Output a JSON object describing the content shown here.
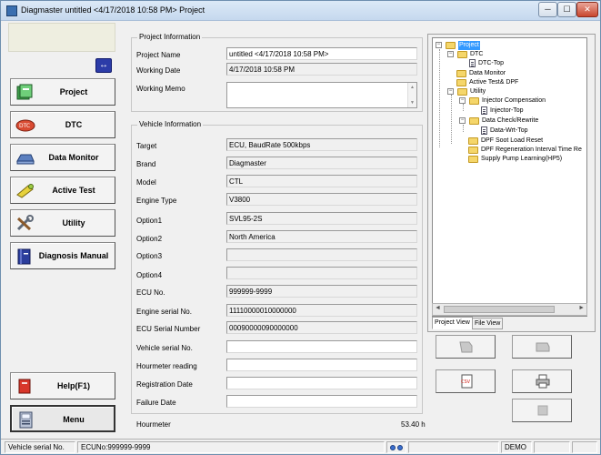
{
  "window": {
    "title": "Diagmaster untitled <4/17/2018 10:58 PM> Project",
    "minimize_glyph": "─",
    "maximize_glyph": "☐",
    "close_glyph": "✕"
  },
  "sidebar": {
    "swap_glyph": "↔",
    "items": [
      {
        "label": "Project",
        "icon": "project-icon"
      },
      {
        "label": "DTC",
        "icon": "dtc-icon"
      },
      {
        "label": "Data Monitor",
        "icon": "data-monitor-icon"
      },
      {
        "label": "Active Test",
        "icon": "active-test-icon"
      },
      {
        "label": "Utility",
        "icon": "utility-icon"
      },
      {
        "label": "Diagnosis Manual",
        "icon": "manual-icon"
      }
    ],
    "help_label": "Help(F1)",
    "menu_label": "Menu"
  },
  "project_info": {
    "group_title": "Project Information",
    "project_name_label": "Project Name",
    "project_name_value": "untitled <4/17/2018 10:58 PM>",
    "working_date_label": "Working Date",
    "working_date_value": "4/17/2018 10:58 PM",
    "working_memo_label": "Working Memo",
    "working_memo_value": ""
  },
  "vehicle_info": {
    "group_title": "Vehicle Information",
    "fields": [
      {
        "label": "Target",
        "value": "ECU, BaudRate 500kbps"
      },
      {
        "label": "Brand",
        "value": "Diagmaster"
      },
      {
        "label": "Model",
        "value": "CTL"
      },
      {
        "label": "Engine Type",
        "value": "V3800"
      },
      {
        "label": "Option1",
        "value": "SVL95-2S"
      },
      {
        "label": "Option2",
        "value": "North America"
      },
      {
        "label": "Option3",
        "value": ""
      },
      {
        "label": "Option4",
        "value": ""
      },
      {
        "label": "ECU No.",
        "value": "999999-9999"
      },
      {
        "label": "Engine serial No.",
        "value": "11110000010000000"
      },
      {
        "label": "ECU Serial Number",
        "value": "00090000090000000"
      },
      {
        "label": "Vehicle serial No.",
        "value": ""
      },
      {
        "label": "Hourmeter reading",
        "value": ""
      },
      {
        "label": "Registration Date",
        "value": ""
      },
      {
        "label": "Failure Date",
        "value": ""
      }
    ],
    "hourmeter_label": "Hourmeter",
    "hourmeter_value": "53.40 h"
  },
  "tree": {
    "nodes": [
      {
        "label": "Project",
        "type": "folder",
        "selected": true
      },
      {
        "label": "DTC",
        "type": "folder"
      },
      {
        "label": "DTC-Top",
        "type": "doc"
      },
      {
        "label": "Data Monitor",
        "type": "folder"
      },
      {
        "label": "Active Test& DPF",
        "type": "folder"
      },
      {
        "label": "Utility",
        "type": "folder"
      },
      {
        "label": "Injector Compensation",
        "type": "folder"
      },
      {
        "label": "Injector-Top",
        "type": "doc"
      },
      {
        "label": "Data Check/Rewrite",
        "type": "folder"
      },
      {
        "label": "Data-Wrt-Top",
        "type": "doc"
      },
      {
        "label": "DPF Soot Load Reset",
        "type": "folder"
      },
      {
        "label": "DPF Regeneration Interval Time Re",
        "type": "folder"
      },
      {
        "label": "Supply Pump Learning(HP5)",
        "type": "folder"
      }
    ],
    "tabs": [
      "Project View",
      "File View"
    ],
    "scroll_left": "◄",
    "scroll_right": "►"
  },
  "actions": [
    "read-vehicle-icon",
    "write-vehicle-icon",
    "csv-export-icon",
    "print-icon",
    "stop-icon"
  ],
  "statusbar": {
    "vehicle_serial_label": "Vehicle serial No.",
    "ecu_no": "ECUNo:999999-9999",
    "mode": "DEMO"
  }
}
